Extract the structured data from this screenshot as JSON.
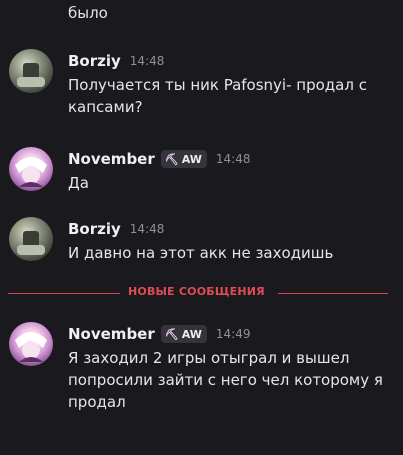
{
  "continuation_text": "было",
  "new_messages_label": "НОВЫЕ СООБЩЕНИЯ",
  "colors": {
    "background": "#1a1a1e",
    "divider": "#e04c53",
    "timestamp": "#8f9099"
  },
  "messages": [
    {
      "user": "Borziy",
      "tag": "",
      "time": "14:48",
      "lines": [
        "Получается ты ник Pafosnyi- продал с",
        "капсами?"
      ]
    },
    {
      "user": "November",
      "tag": "AW",
      "tag_icon": "pickaxe-icon",
      "time": "14:48",
      "lines": [
        "Да"
      ]
    },
    {
      "user": "Borziy",
      "tag": "",
      "time": "14:48",
      "lines": [
        "И давно на этот акк не заходишь"
      ]
    },
    {
      "user": "November",
      "tag": "AW",
      "tag_icon": "pickaxe-icon",
      "time": "14:49",
      "lines": [
        "Я заходил 2 игры отыграл и вышел",
        "попросили зайти с него чел которому я",
        "продал"
      ]
    }
  ]
}
